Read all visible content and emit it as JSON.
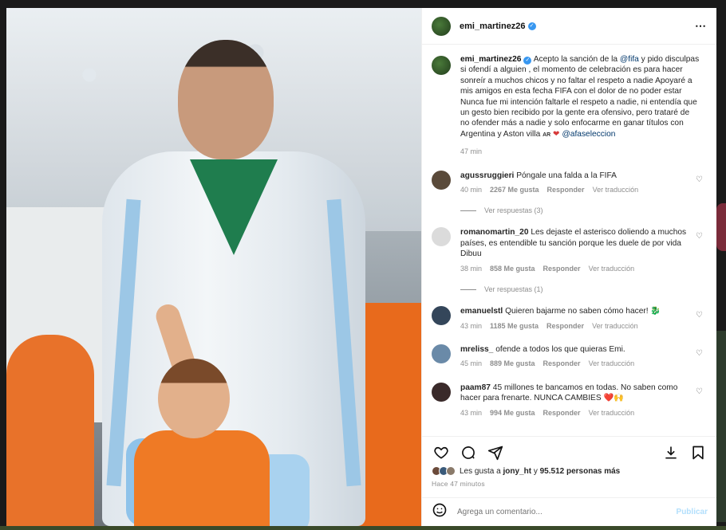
{
  "post": {
    "username": "emi_martinez26",
    "more_icon": "⋯",
    "caption_user": "emi_martinez26",
    "caption_p1": " Acepto la sanción de la ",
    "caption_mention1": "@fifa",
    "caption_p2": " y pido disculpas si ofendí a alguien , el momento de celebración es para hacer sonreír a muchos chicos y no faltar el respeto a nadie Apoyaré a mis amigos en esta fecha FIFA con el dolor de no poder estar",
    "caption_p3": "Nunca fue mi intención faltarle el respeto a nadie, ni entendía que un gesto bien recibido por la gente era ofensivo, pero trataré de no ofender más a nadie y solo enfocarme en ganar títulos con Argentina y Aston villa ",
    "caption_flag": "AR",
    "caption_mention2": "@afaseleccion",
    "caption_time": "47 min"
  },
  "comments": [
    {
      "user": "agussruggieri",
      "text": "Póngale una falda a la FIFA",
      "time": "40 min",
      "likes": "2267 Me gusta",
      "reply": "Responder",
      "translate": "Ver traducción",
      "replies": "Ver respuestas (3)",
      "avatar_color": "#5a4a3a"
    },
    {
      "user": "romanomartin_20",
      "text": "Les dejaste el asterisco doliendo a muchos países, es entendible tu sanción porque les duele de por vida Dibuu",
      "time": "38 min",
      "likes": "858 Me gusta",
      "reply": "Responder",
      "translate": "Ver traducción",
      "replies": "Ver respuestas (1)",
      "avatar_color": "#dbdbdb"
    },
    {
      "user": "emanuelstl",
      "text": "Quieren bajarme no saben cómo hacer! 🐉",
      "time": "43 min",
      "likes": "1185 Me gusta",
      "reply": "Responder",
      "translate": "Ver traducción",
      "avatar_color": "#34465a"
    },
    {
      "user": "mreliss_",
      "text": "ofende a todos los que quieras Emi.",
      "time": "45 min",
      "likes": "889 Me gusta",
      "reply": "Responder",
      "translate": "Ver traducción",
      "avatar_color": "#6a8aa8"
    },
    {
      "user": "paam87",
      "text": "45 millones te bancamos en todas. No saben como hacer para frenarte. NUNCA CAMBIES ❤️🙌",
      "time": "43 min",
      "likes": "994 Me gusta",
      "reply": "Responder",
      "translate": "Ver traducción",
      "avatar_color": "#3a2a2a"
    }
  ],
  "actions": {
    "like_icon": "heart-icon",
    "comment_icon": "comment-icon",
    "share_icon": "send-icon",
    "download_icon": "download-icon",
    "save_icon": "bookmark-icon"
  },
  "likes": {
    "prefix": "Les gusta a ",
    "user": "jony_ht",
    "middle": " y ",
    "count": "95.512 personas más"
  },
  "ago": "Hace 47 minutos",
  "add_comment": {
    "placeholder": "Agrega un comentario...",
    "publish": "Publicar"
  },
  "colors": {
    "accent": "#3897f0",
    "mention": "#00376b",
    "muted": "#8e8e8e",
    "heart": "#d83a3a"
  }
}
